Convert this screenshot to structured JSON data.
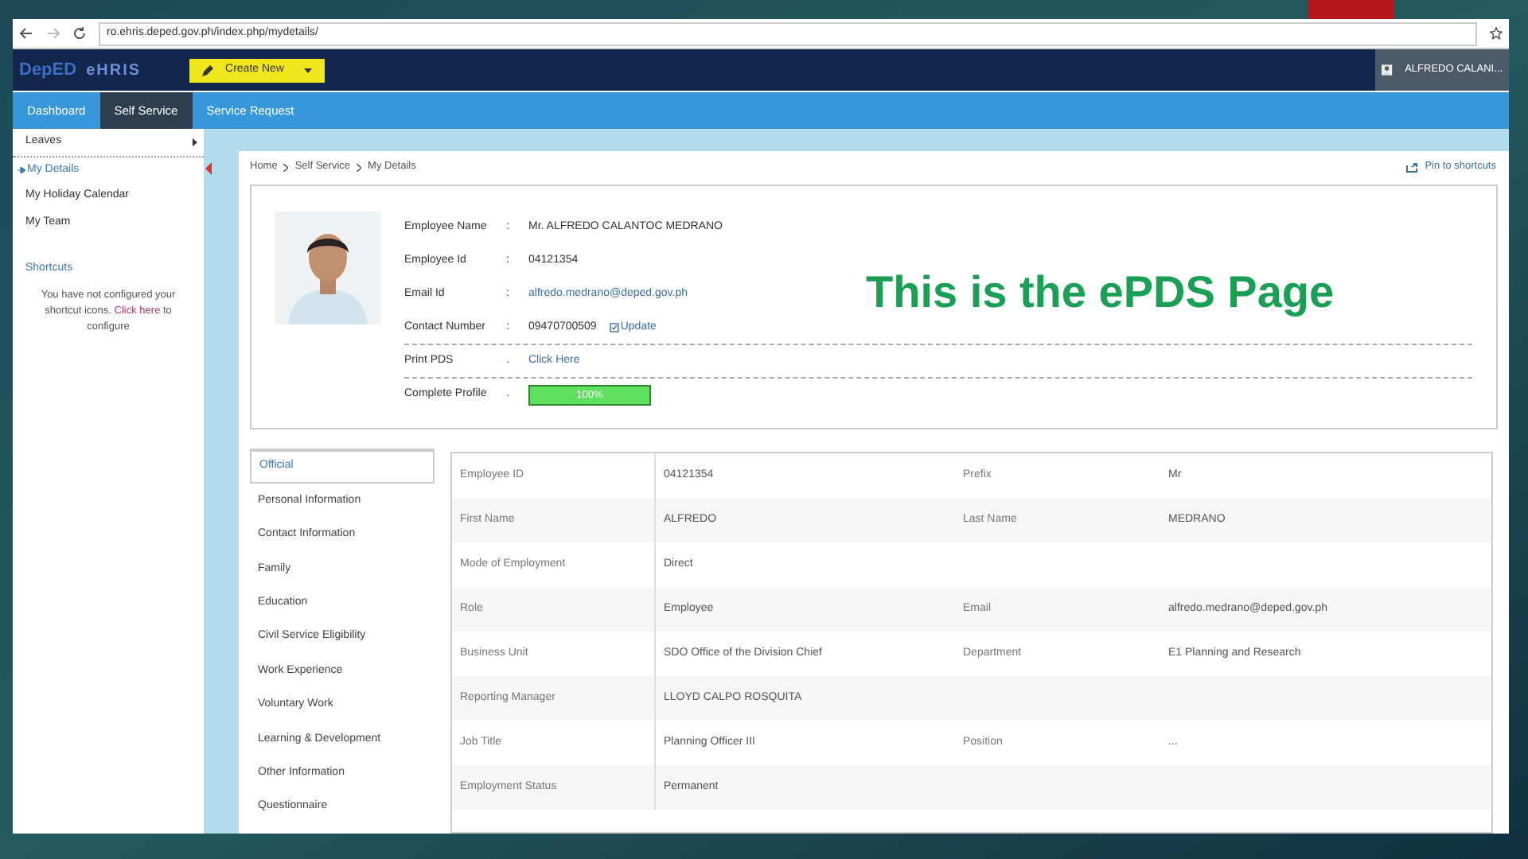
{
  "browser": {
    "url": "ro.ehris.deped.gov.ph/index.php/mydetails/"
  },
  "header": {
    "logo_1": "DepED",
    "logo_2": "eHRIS",
    "create_button": "Create New",
    "user": "ALFREDO CALANI..."
  },
  "nav": [
    {
      "label": "Dashboard",
      "selected": false
    },
    {
      "label": "Self Service",
      "selected": true
    },
    {
      "label": "Service Request",
      "selected": false
    }
  ],
  "sidebar": {
    "items": [
      {
        "label": "Leaves",
        "selected": false,
        "submenu": true
      },
      {
        "label": "My Details",
        "selected": true,
        "submenu": false
      },
      {
        "label": "My Holiday Calendar",
        "selected": false,
        "submenu": false
      },
      {
        "label": "My Team",
        "selected": false,
        "submenu": false
      }
    ],
    "shortcuts_title": "Shortcuts",
    "shortcuts_text": "You have not configured your shortcut icons.",
    "shortcuts_link": "Click here",
    "shortcuts_after": "to configure"
  },
  "breadcrumb": [
    "Home",
    "Self Service",
    "My Details"
  ],
  "pin_link": "Pin to shortcuts",
  "profile": [
    {
      "kind": "text",
      "label": "Employee Name",
      "separator": ":",
      "value": "Mr. ALFREDO CALANTOC MEDRANO"
    },
    {
      "kind": "text",
      "label": "Employee Id",
      "separator": ":",
      "value": "04121354"
    },
    {
      "kind": "link",
      "label": "Email Id",
      "separator": ":",
      "value": "alfredo.medrano@deped.gov.ph"
    },
    {
      "kind": "text",
      "label": "Contact Number",
      "separator": ":",
      "value": "09470700509",
      "action": "Update"
    },
    {
      "kind": "link",
      "label": "Print PDS",
      "separator": ".",
      "value": "Click Here"
    },
    {
      "kind": "progress",
      "label": "Complete Profile",
      "separator": ".",
      "value": "100%",
      "level": 1
    }
  ],
  "overlay_caption": "This is the ePDS Page",
  "tabs": [
    {
      "label": "Official",
      "selected": true
    },
    {
      "label": "Personal Information",
      "selected": false
    },
    {
      "label": "Contact Information",
      "selected": false
    },
    {
      "label": "Family",
      "selected": false
    },
    {
      "label": "Education",
      "selected": false
    },
    {
      "label": "Civil Service Eligibility",
      "selected": false
    },
    {
      "label": "Work Experience",
      "selected": false
    },
    {
      "label": "Voluntary Work",
      "selected": false
    },
    {
      "label": "Learning & Development",
      "selected": false
    },
    {
      "label": "Other Information",
      "selected": false
    },
    {
      "label": "Questionnaire",
      "selected": false
    }
  ],
  "details": [
    {
      "label": "Employee ID",
      "value": "04121354",
      "label_2": "Prefix",
      "value_2": "Mr"
    },
    {
      "label": "First Name",
      "value": "ALFREDO",
      "label_2": "Last Name",
      "value_2": "MEDRANO"
    },
    {
      "label": "Mode of Employment",
      "value": "Direct"
    },
    {
      "label": "Role",
      "value": "Employee",
      "label_2": "Email",
      "value_2": "alfredo.medrano@deped.gov.ph"
    },
    {
      "label": "Business Unit",
      "value": "SDO Office of the Division Chief",
      "label_2": "Department",
      "value_2": "E1 Planning and Research"
    },
    {
      "label": "Reporting Manager",
      "value": "LLOYD CALPO ROSQUITA"
    },
    {
      "label": "Job Title",
      "value": "Planning Officer III",
      "label_2": "Position",
      "value_2": "..."
    },
    {
      "label": "Employment Status",
      "value": "Permanent"
    }
  ]
}
